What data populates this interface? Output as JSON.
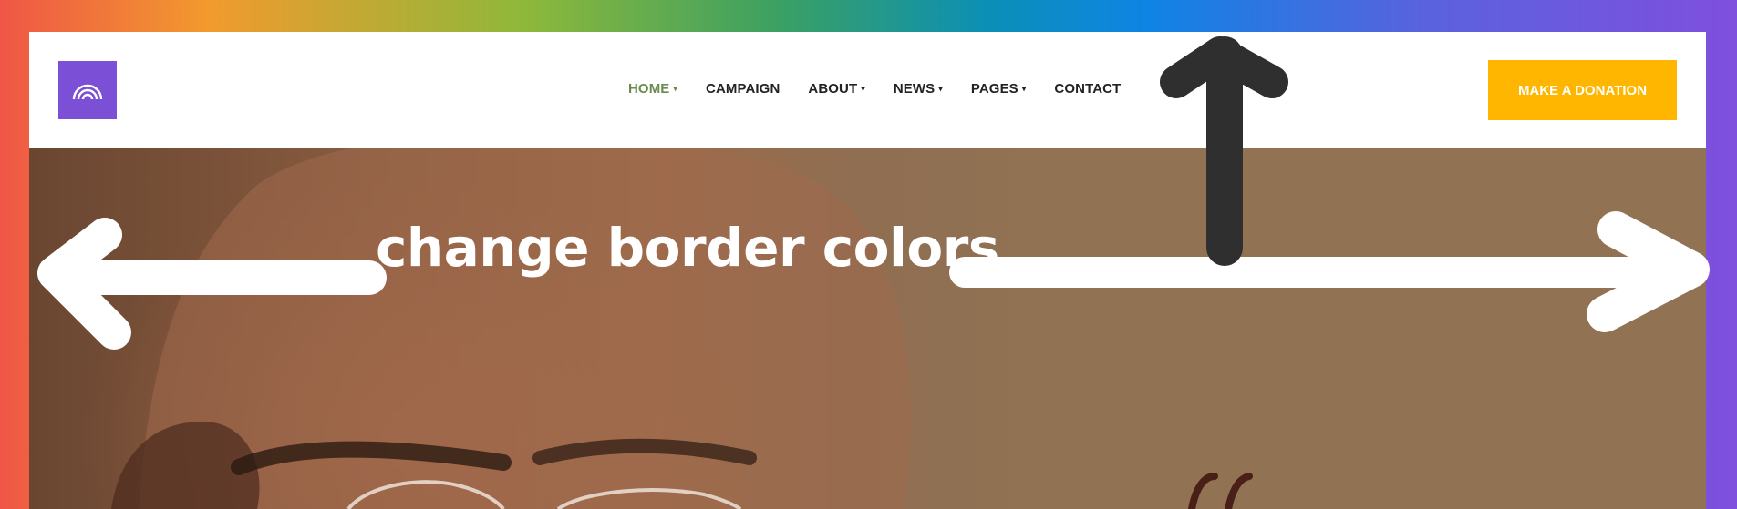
{
  "nav": {
    "items": [
      {
        "label": "HOME",
        "caret": "▾",
        "active": true
      },
      {
        "label": "CAMPAIGN",
        "caret": "",
        "active": false
      },
      {
        "label": "ABOUT",
        "caret": "▾",
        "active": false
      },
      {
        "label": "NEWS",
        "caret": "▾",
        "active": false
      },
      {
        "label": "PAGES",
        "caret": "▾",
        "active": false
      },
      {
        "label": "CONTACT",
        "caret": "",
        "active": false
      }
    ]
  },
  "header": {
    "donate_label": "MAKE A DONATION",
    "logo_icon": "rainbow-icon"
  },
  "annotation": {
    "caption": "change border colors"
  },
  "colors": {
    "logo_bg": "#7b4fd6",
    "donate_bg": "#ffb600",
    "active_nav": "#6a8c4f",
    "border_gradient_start": "#ef5646",
    "border_gradient_end": "#7f4fdd"
  }
}
